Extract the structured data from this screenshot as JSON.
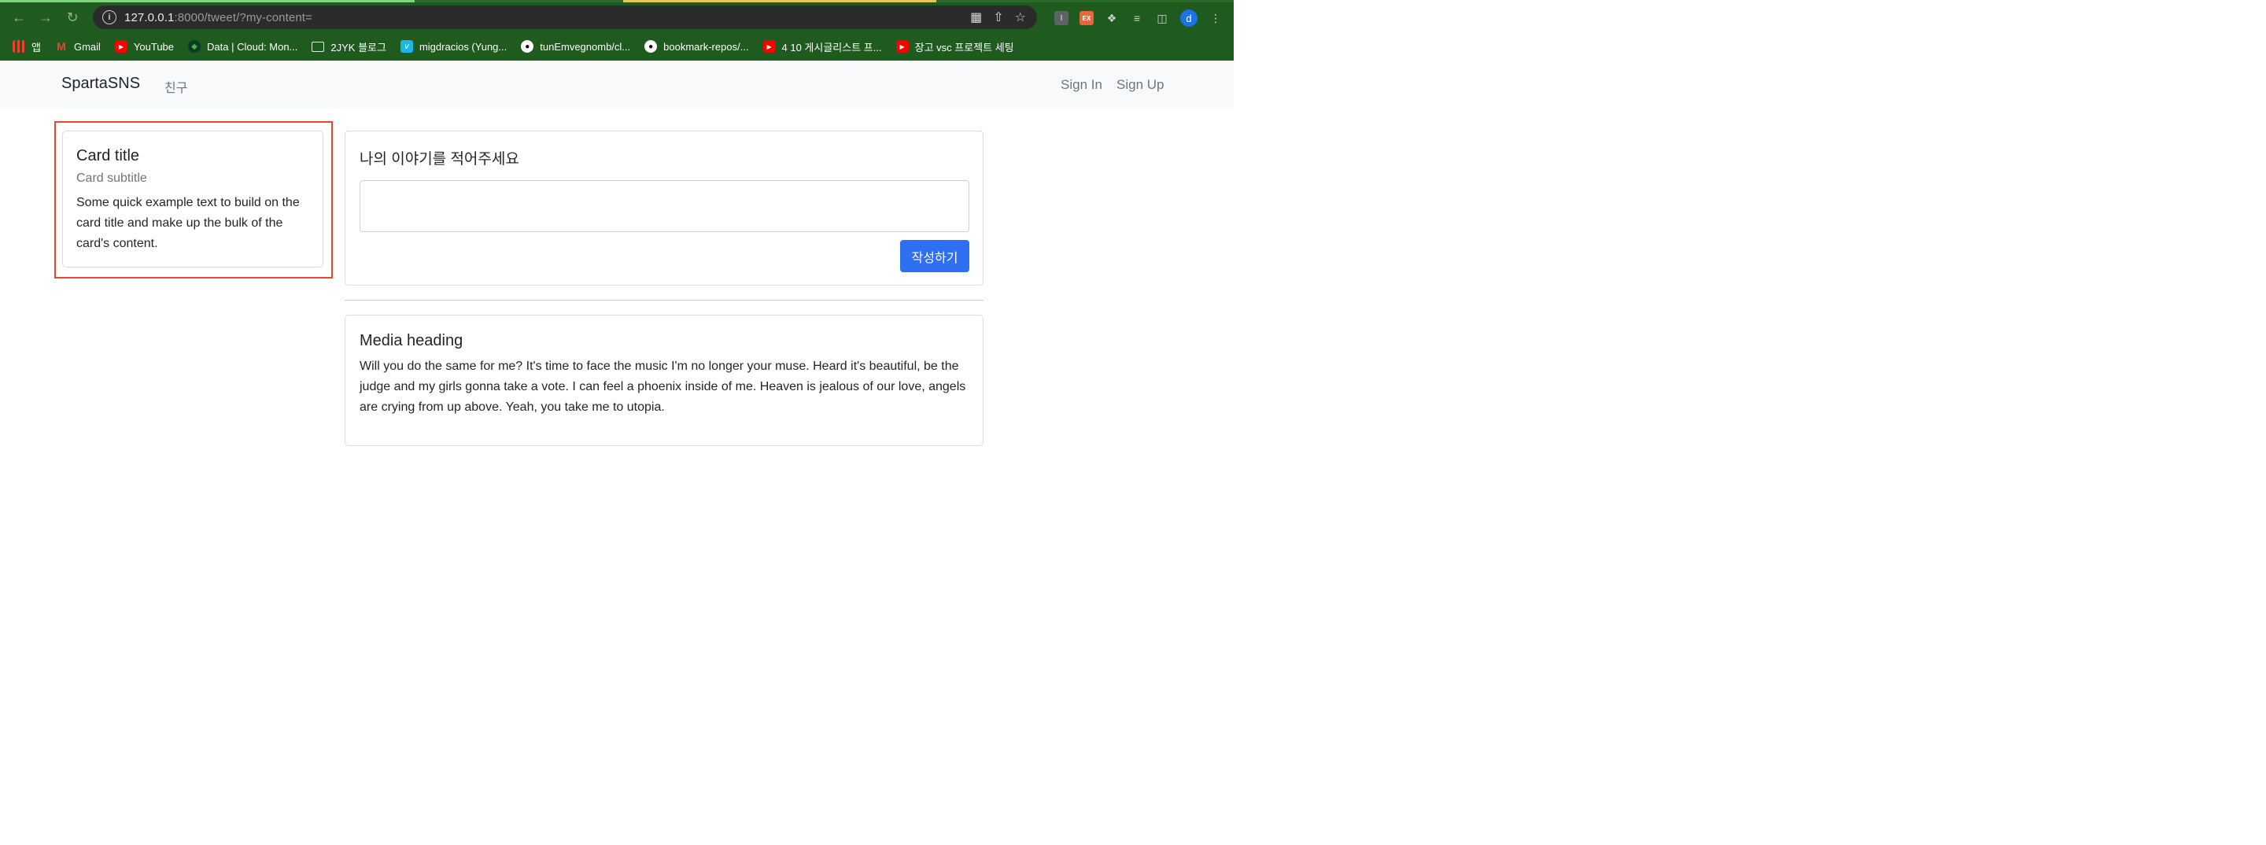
{
  "browser": {
    "url_host": "127.0.0.1",
    "url_rest": ":8000/tweet/?my-content=",
    "bookmarks": [
      {
        "label": "앱",
        "icon": "apps-icon"
      },
      {
        "label": "Gmail",
        "icon": "gmail-icon"
      },
      {
        "label": "YouTube",
        "icon": "youtube-icon"
      },
      {
        "label": "Data | Cloud: Mon...",
        "icon": "mongodb-icon"
      },
      {
        "label": "2JYK 블로그",
        "icon": "folder-icon"
      },
      {
        "label": "migdracios (Yung...",
        "icon": "vimeo-icon"
      },
      {
        "label": "tunEmvegnomb/cl...",
        "icon": "github-icon"
      },
      {
        "label": "bookmark-repos/...",
        "icon": "github-icon"
      },
      {
        "label": "4 10 게시글리스트 프...",
        "icon": "youtube-icon"
      },
      {
        "label": "장고 vsc 프로젝트 세팅",
        "icon": "youtube-icon"
      }
    ],
    "profile_initial": "d",
    "ext_label": "EX"
  },
  "navbar": {
    "brand": "SpartaSNS",
    "friends": "친구",
    "sign_in": "Sign In",
    "sign_up": "Sign Up"
  },
  "profile_card": {
    "title": "Card title",
    "subtitle": "Card subtitle",
    "text": "Some quick example text to build on the card title and make up the bulk of the card's content."
  },
  "write_card": {
    "heading": "나의 이야기를 적어주세요",
    "textarea_value": "",
    "submit_label": "작성하기"
  },
  "media_card": {
    "heading": "Media heading",
    "text": "Will you do the same for me? It's time to face the music I'm no longer your muse. Heard it's beautiful, be the judge and my girls gonna take a vote. I can feel a phoenix inside of me. Heaven is jealous of our love, angels are crying from up above. Yeah, you take me to utopia."
  },
  "colors": {
    "chrome_bg": "#1f5a1f",
    "primary": "#2f6ff2",
    "highlight": "#e44a33",
    "navbar_bg": "#f8f9fa"
  }
}
